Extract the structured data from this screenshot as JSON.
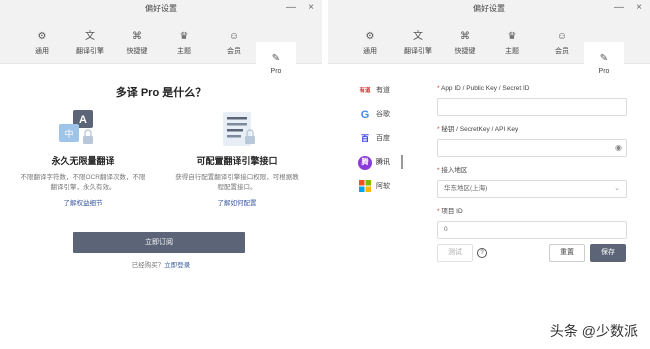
{
  "window_title": "偏好设置",
  "controls": {
    "minimize": "—",
    "close": "×"
  },
  "tabs": [
    {
      "icon": "⚙",
      "label": "通用"
    },
    {
      "icon": "文",
      "label": "翻译引擎"
    },
    {
      "icon": "⌘",
      "label": "快捷键"
    },
    {
      "icon": "♛",
      "label": "主题"
    },
    {
      "icon": "☺",
      "label": "会员"
    },
    {
      "icon": "✎",
      "label": "Pro"
    }
  ],
  "pro": {
    "title": "多译 Pro 是什么？",
    "feature1": {
      "heading": "永久无限量翻译",
      "desc": "不限翻译字符数，不限OCR翻译次数，不限翻译引擎，永久有效。",
      "link": "了解权益细节"
    },
    "feature2": {
      "heading": "可配置翻译引擎接口",
      "desc": "获得自行配置翻译引擎接口权限，可根据教程配置接口。",
      "link": "了解如何配置"
    },
    "subscribe_label": "立即订阅",
    "bought_text": "已经购买？",
    "login_link": "立即登录"
  },
  "engines": [
    {
      "icon": "有道",
      "label": "有道"
    },
    {
      "icon": "G",
      "label": "谷歌"
    },
    {
      "icon": "百",
      "label": "百度"
    },
    {
      "icon": "腾",
      "label": "腾讯"
    },
    {
      "icon": "■",
      "label": "阿软"
    }
  ],
  "form": {
    "app_id_label": "App ID / Public Key / Secret ID",
    "app_id_value": "",
    "secret_label": "秘钥 / SecretKey / API Key",
    "secret_value": "",
    "region_label": "接入地区",
    "region_value": "华东地区(上海)",
    "project_label": "项目 ID",
    "project_value": "0"
  },
  "buttons": {
    "test": "测试",
    "help": "?",
    "reset": "重置",
    "save": "保存"
  },
  "watermark": "头条 @少数派",
  "colors": {
    "accent": "#5b6577",
    "link": "#3a5a9c",
    "required": "#d33333"
  }
}
